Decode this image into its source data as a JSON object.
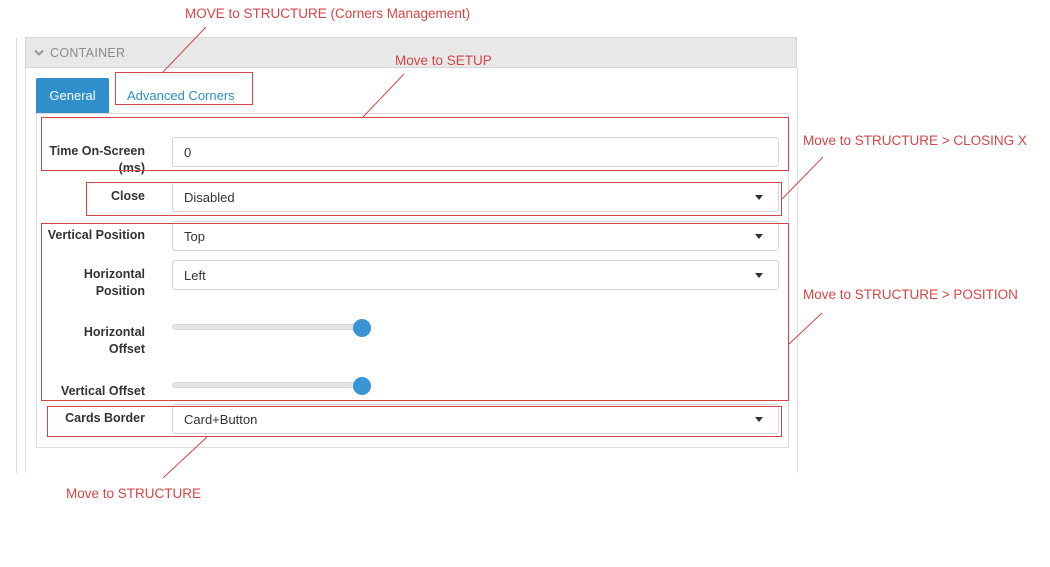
{
  "panel": {
    "title": "CONTAINER"
  },
  "tabs": [
    {
      "label": "General",
      "active": true
    },
    {
      "label": "Advanced Corners",
      "active": false
    }
  ],
  "form": {
    "time_on_screen": {
      "label_line1": "Time On-Screen",
      "label_line2": "(ms)",
      "value": "0"
    },
    "close": {
      "label": "Close",
      "value": "Disabled"
    },
    "vertical_position": {
      "label": "Vertical Position",
      "value": "Top"
    },
    "horizontal_position": {
      "label_line1": "Horizontal",
      "label_line2": "Position",
      "value": "Left"
    },
    "horizontal_offset": {
      "label_line1": "Horizontal",
      "label_line2": "Offset",
      "level_percent": 100
    },
    "vertical_offset": {
      "label": "Vertical Offset",
      "level_percent": 100
    },
    "cards_border": {
      "label": "Cards Border",
      "value": "Card+Button"
    }
  },
  "annotations": {
    "corners": "MOVE to STRUCTURE (Corners Management)",
    "setup": "Move to SETUP",
    "closing_x": "Move to STRUCTURE > CLOSING X",
    "position": "Move to STRUCTURE > POSITION",
    "structure": "Move to STRUCTURE"
  },
  "colors": {
    "accent": "#2e8fcb",
    "annotation": "#d64545",
    "slider_handle": "#3a95d4"
  },
  "icons": {
    "panel_toggle": "chevron-down-icon",
    "select_caret": "caret-down-icon"
  }
}
